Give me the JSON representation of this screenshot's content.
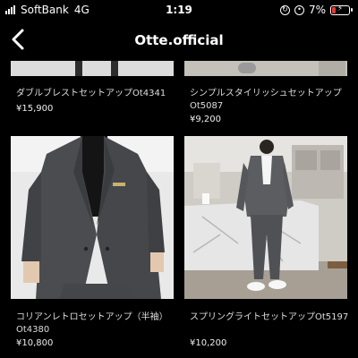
{
  "status_bar": {
    "carrier": "SoftBank",
    "network": "4G",
    "time": "1:19",
    "battery": "7%"
  },
  "header": {
    "title": "Otte.official"
  },
  "products": [
    {
      "name": "ダブルブレストセットアップOt4341",
      "price": "¥15,900"
    },
    {
      "name": "シンプルスタイリッシュセットアップOt5087",
      "price": "¥9,200"
    },
    {
      "name": "コリアンレトロセットアップ（半袖）Ot4380",
      "price": "¥10,800"
    },
    {
      "name": "スプリングライトセットアップOt5197",
      "price": "¥10,200"
    }
  ],
  "icons": [
    "signal-icon",
    "lock-rotation-icon",
    "alarm-icon",
    "battery-icon",
    "back-arrow-icon"
  ],
  "colors": {
    "background": "#000000",
    "battery_low": "#e53935"
  }
}
